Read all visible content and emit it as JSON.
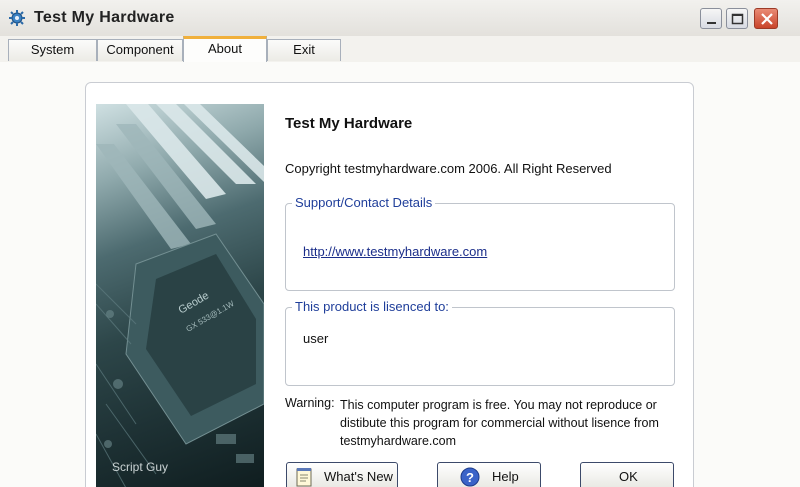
{
  "window": {
    "title": "Test My Hardware"
  },
  "tabs": [
    {
      "label": "System"
    },
    {
      "label": "Component"
    },
    {
      "label": "About",
      "active": true
    },
    {
      "label": "Exit"
    }
  ],
  "about": {
    "heading": "Test My Hardware",
    "copyright": "Copyright testmyhardware.com 2006. All Right Reserved",
    "picture_caption": "Script Guy",
    "support": {
      "legend": "Support/Contact Details",
      "link": "http://www.testmyhardware.com"
    },
    "licence": {
      "legend": "This product is  lisenced to:",
      "user": "user"
    },
    "warning_label": "Warning:",
    "warning_lines": [
      "This computer program is free. You may not reproduce or",
      "distibute this program for commercial without lisence from",
      "testmyhardware.com"
    ]
  },
  "buttons": {
    "whats_new": "What's New",
    "help": "Help",
    "ok": "OK"
  },
  "colors": {
    "tab_accent": "#f0b03c",
    "legend_text": "#1f3e9a",
    "link": "#1b2e8a",
    "close_button": "#c9442a"
  },
  "icons": [
    "gear-icon",
    "minimize-icon",
    "maximize-icon",
    "close-icon",
    "notepad-icon",
    "help-icon"
  ]
}
